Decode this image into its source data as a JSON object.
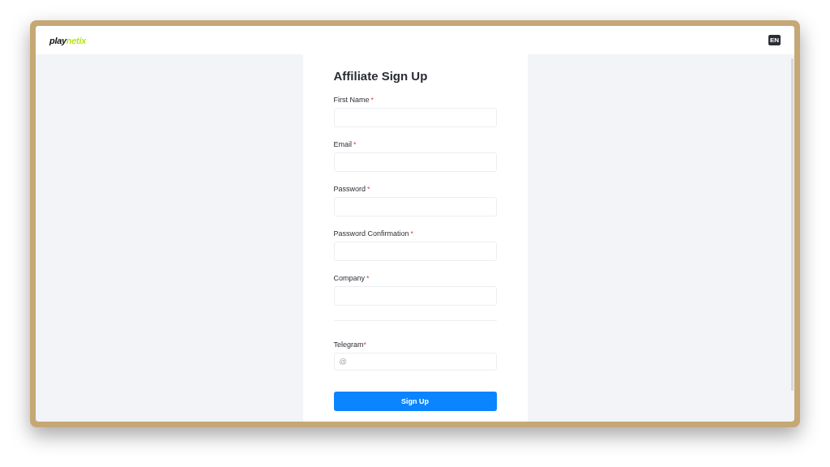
{
  "header": {
    "logo": {
      "part_1": "play",
      "part_2": "netix"
    },
    "language": "EN"
  },
  "form": {
    "title": "Affiliate Sign Up",
    "fields": [
      {
        "label": "First Name",
        "required_mark": "*"
      },
      {
        "label": "Email",
        "required_mark": "*"
      },
      {
        "label": "Password",
        "required_mark": "*"
      },
      {
        "label": "Password Confirmation",
        "required_mark": "*"
      },
      {
        "label": "Company",
        "required_mark": "*"
      }
    ],
    "telegram": {
      "label": "Telegram",
      "required_mark": "*",
      "placeholder": "@"
    },
    "submit": "Sign Up"
  }
}
